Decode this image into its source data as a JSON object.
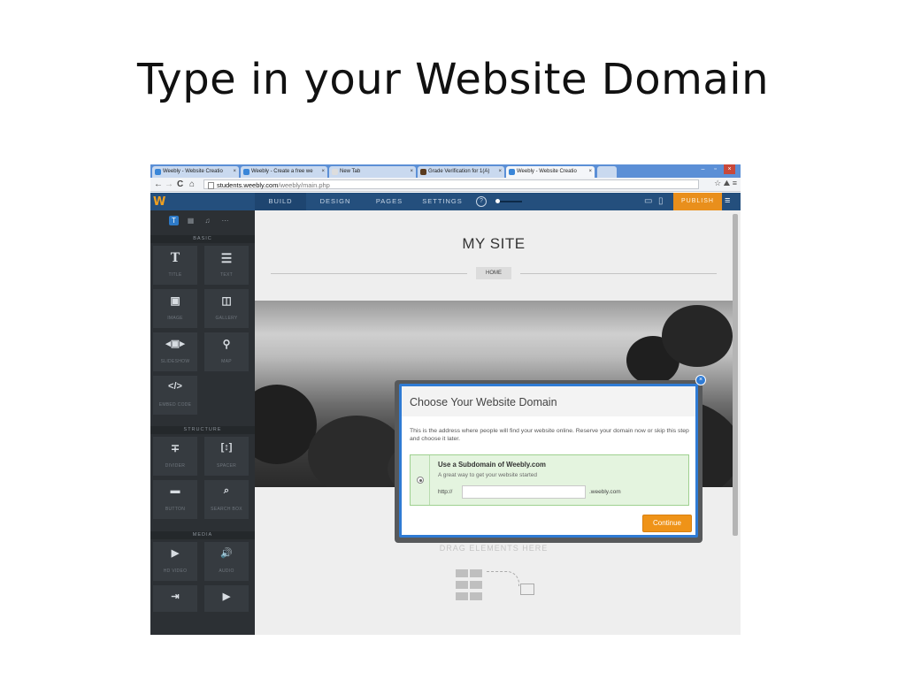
{
  "slide_title": "Type in your Website Domain",
  "browser": {
    "tabs": [
      {
        "title": "Weebly - Website Creatio",
        "active": false
      },
      {
        "title": "Weebly - Create a free we",
        "active": false
      },
      {
        "title": "New Tab",
        "active": false
      },
      {
        "title": "Grade Verification for 1(A)",
        "active": false
      },
      {
        "title": "Weebly - Website Creatio",
        "active": true
      }
    ],
    "url_host": "students.weebly.com",
    "url_path": "/weebly/main.php"
  },
  "weebly_toolbar": {
    "logo": "W",
    "tabs": [
      "BUILD",
      "DESIGN",
      "PAGES",
      "SETTINGS"
    ],
    "help": "?",
    "publish": "PUBLISH"
  },
  "sidebar": {
    "sections": {
      "basic": "BASIC",
      "structure": "STRUCTURE",
      "media": "MEDIA"
    },
    "basic": [
      {
        "label": "TITLE",
        "icon": "title-icon"
      },
      {
        "label": "TEXT",
        "icon": "text-icon"
      },
      {
        "label": "IMAGE",
        "icon": "image-icon"
      },
      {
        "label": "GALLERY",
        "icon": "gallery-icon"
      },
      {
        "label": "SLIDESHOW",
        "icon": "slideshow-icon"
      },
      {
        "label": "MAP",
        "icon": "map-icon"
      },
      {
        "label": "EMBED CODE",
        "icon": "embed-code-icon"
      }
    ],
    "structure": [
      {
        "label": "DIVIDER",
        "icon": "divider-icon"
      },
      {
        "label": "SPACER",
        "icon": "spacer-icon"
      },
      {
        "label": "BUTTON",
        "icon": "button-icon"
      },
      {
        "label": "SEARCH BOX",
        "icon": "search-box-icon"
      }
    ],
    "media": [
      {
        "label": "HD VIDEO",
        "icon": "hd-video-icon"
      },
      {
        "label": "AUDIO",
        "icon": "audio-icon"
      },
      {
        "label": "",
        "icon": "document-icon"
      },
      {
        "label": "",
        "icon": "youtube-icon"
      }
    ]
  },
  "site": {
    "title": "MY SITE",
    "nav_home": "HOME",
    "drag_text": "DRAG ELEMENTS HERE"
  },
  "modal": {
    "title": "Choose Your Website Domain",
    "description": "This is the address where people will find your website online. Reserve your domain now or skip this step and choose it later.",
    "option_title": "Use a Subdomain of Weebly.com",
    "option_subtitle": "A great way to get your website started",
    "prefix": "http://",
    "input_value": "",
    "suffix": ".weebly.com",
    "continue_label": "Continue"
  },
  "colors": {
    "weebly_blue": "#244f7d",
    "publish_orange": "#e98f1c",
    "modal_border": "#2f7bd4",
    "option_green": "#e4f4df",
    "continue_orange": "#ef9318"
  }
}
